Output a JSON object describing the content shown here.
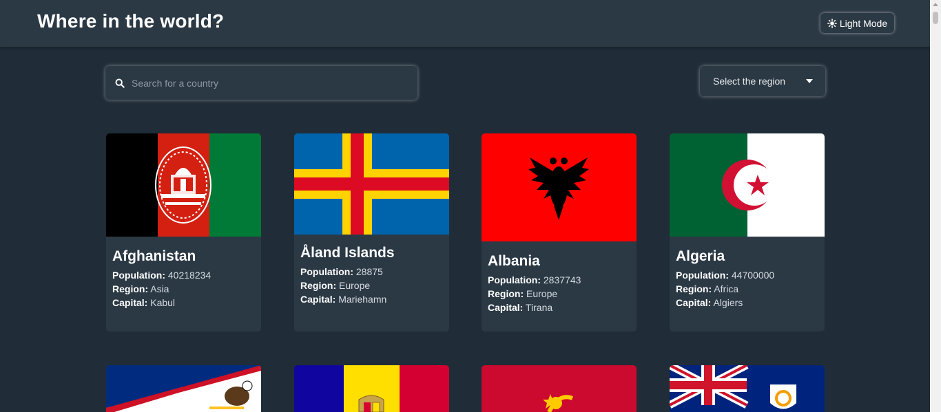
{
  "header": {
    "title": "Where in the world?",
    "mode_label": "Light Mode",
    "mode_icon": "sun-icon"
  },
  "search": {
    "placeholder": "Search for a country",
    "value": "",
    "icon": "search-icon"
  },
  "filter": {
    "label": "Select the region",
    "icon": "caret-down-icon"
  },
  "labels": {
    "population": "Population:",
    "region": "Region:",
    "capital": "Capital:"
  },
  "countries": [
    {
      "name": "Afghanistan",
      "population": "40218234",
      "region": "Asia",
      "capital": "Kabul"
    },
    {
      "name": "Åland Islands",
      "population": "28875",
      "region": "Europe",
      "capital": "Mariehamn"
    },
    {
      "name": "Albania",
      "population": "2837743",
      "region": "Europe",
      "capital": "Tirana"
    },
    {
      "name": "Algeria",
      "population": "44700000",
      "region": "Africa",
      "capital": "Algiers"
    }
  ],
  "colors": {
    "background": "#202c37",
    "element": "#2b3945",
    "text": "#ffffff"
  }
}
